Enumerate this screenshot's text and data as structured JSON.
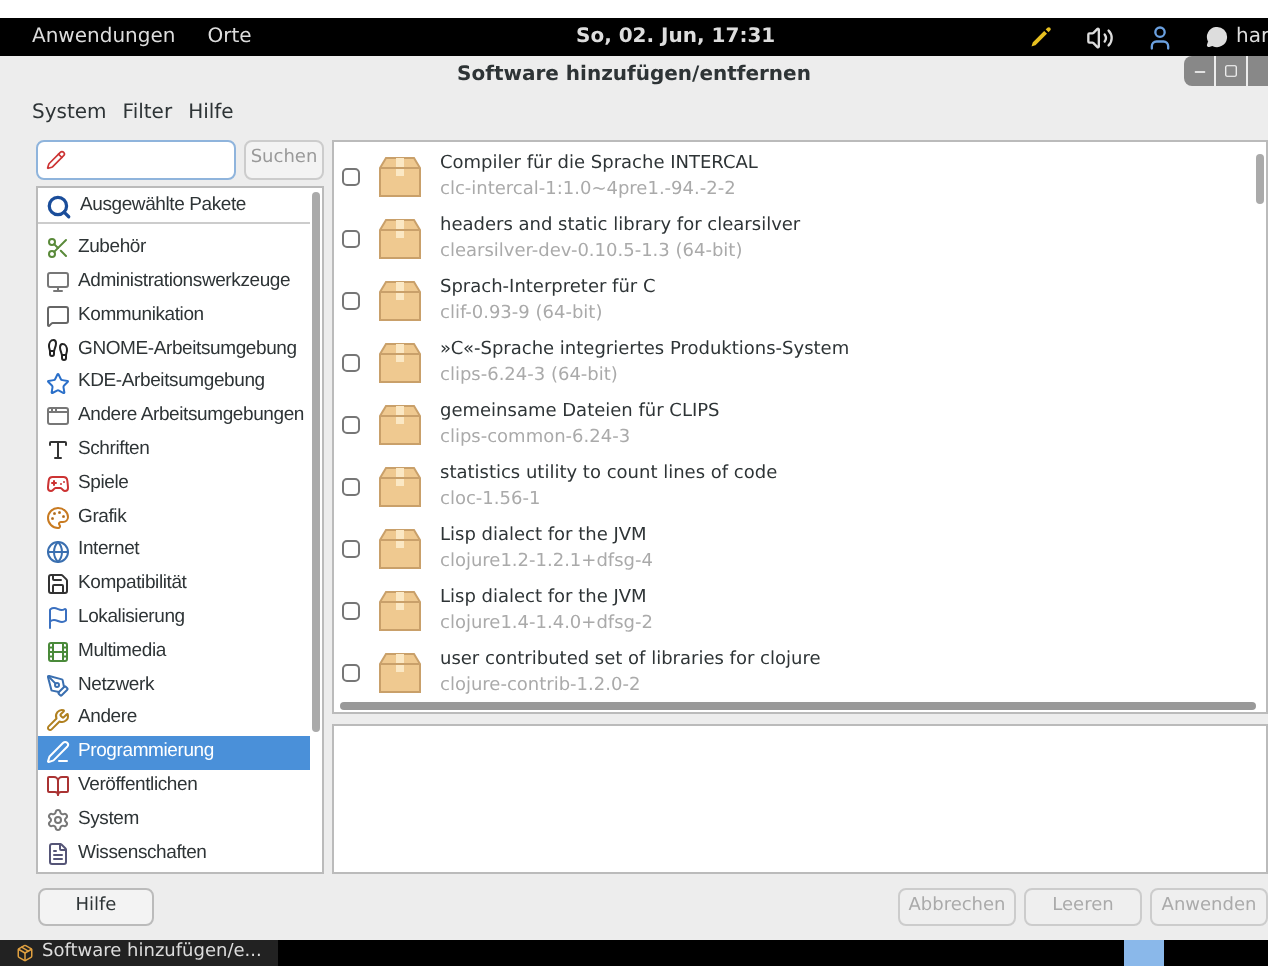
{
  "top_bar": {
    "menus": [
      "Anwendungen",
      "Orte"
    ],
    "clock": "So, 02. Jun, 17:31",
    "user": "har"
  },
  "window": {
    "title": "Software hinzufügen/entfernen"
  },
  "menu_bar": [
    "System",
    "Filter",
    "Hilfe"
  ],
  "search": {
    "button": "Suchen"
  },
  "featured": {
    "label": "Ausgewählte Pakete",
    "selected": false
  },
  "categories": [
    {
      "label": "Zubehör",
      "selected": false
    },
    {
      "label": "Administrationswerkzeuge",
      "selected": false
    },
    {
      "label": "Kommunikation",
      "selected": false
    },
    {
      "label": "GNOME-Arbeitsumgebung",
      "selected": false
    },
    {
      "label": "KDE-Arbeitsumgebung",
      "selected": false
    },
    {
      "label": "Andere Arbeitsumgebungen",
      "selected": false
    },
    {
      "label": "Schriften",
      "selected": false
    },
    {
      "label": "Spiele",
      "selected": false
    },
    {
      "label": "Grafik",
      "selected": false
    },
    {
      "label": "Internet",
      "selected": false
    },
    {
      "label": "Kompatibilität",
      "selected": false
    },
    {
      "label": "Lokalisierung",
      "selected": false
    },
    {
      "label": "Multimedia",
      "selected": false
    },
    {
      "label": "Netzwerk",
      "selected": false
    },
    {
      "label": "Andere",
      "selected": false
    },
    {
      "label": "Programmierung",
      "selected": true
    },
    {
      "label": "Veröffentlichen",
      "selected": false
    },
    {
      "label": "System",
      "selected": false
    },
    {
      "label": "Wissenschaften",
      "selected": false
    }
  ],
  "packages": [
    {
      "summary": "Compiler für die Sprache INTERCAL",
      "name": "clc-intercal-1:1.0~4pre1.-94.-2-2",
      "checked": false
    },
    {
      "summary": "headers and static library for clearsilver",
      "name": "clearsilver-dev-0.10.5-1.3 (64-bit)",
      "checked": false
    },
    {
      "summary": "Sprach-Interpreter für C",
      "name": "clif-0.93-9 (64-bit)",
      "checked": false
    },
    {
      "summary": "»C«-Sprache integriertes Produktions-System",
      "name": "clips-6.24-3 (64-bit)",
      "checked": false
    },
    {
      "summary": "gemeinsame Dateien für CLIPS",
      "name": "clips-common-6.24-3",
      "checked": false
    },
    {
      "summary": "statistics utility to count lines of code",
      "name": "cloc-1.56-1",
      "checked": false
    },
    {
      "summary": "Lisp dialect for the JVM",
      "name": "clojure1.2-1.2.1+dfsg-4",
      "checked": false
    },
    {
      "summary": "Lisp dialect for the JVM",
      "name": "clojure1.4-1.4.0+dfsg-2",
      "checked": false
    },
    {
      "summary": "user contributed set of libraries for clojure",
      "name": "clojure-contrib-1.2.0-2",
      "checked": false
    }
  ],
  "buttons": {
    "help": "Hilfe",
    "actions": [
      "Abbrechen",
      "Leeren",
      "Anwenden"
    ]
  },
  "taskbar": {
    "task": "Software hinzufügen/e..."
  }
}
